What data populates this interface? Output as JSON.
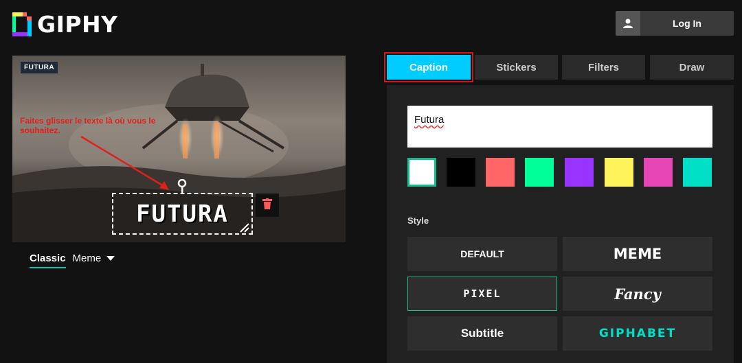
{
  "header": {
    "logo_text": "GIPHY",
    "login_label": "Log In"
  },
  "preview": {
    "badge": "FUTURA",
    "annotation": "Faites glisser le texte là où vous le souhaitez.",
    "caption_text": "FUTURA"
  },
  "style_tabs": {
    "classic": "Classic",
    "meme": "Meme"
  },
  "tabs": [
    {
      "label": "Caption",
      "active": true
    },
    {
      "label": "Stickers",
      "active": false
    },
    {
      "label": "Filters",
      "active": false
    },
    {
      "label": "Draw",
      "active": false
    }
  ],
  "editor": {
    "caption_value": "Futura",
    "colors": [
      "#ffffff",
      "#000000",
      "#ff6666",
      "#00ff99",
      "#9933ff",
      "#fff35c",
      "#e646b6",
      "#00e0c7"
    ],
    "selected_color": "#ffffff",
    "style_label": "Style",
    "styles": [
      {
        "label": "DEFAULT",
        "selected": false
      },
      {
        "label": "MEME",
        "selected": false
      },
      {
        "label": "PIXEL",
        "selected": true
      },
      {
        "label": "Fancy",
        "selected": false
      },
      {
        "label": "Subtitle",
        "selected": false
      },
      {
        "label": "GIPHABET",
        "selected": false
      }
    ]
  }
}
